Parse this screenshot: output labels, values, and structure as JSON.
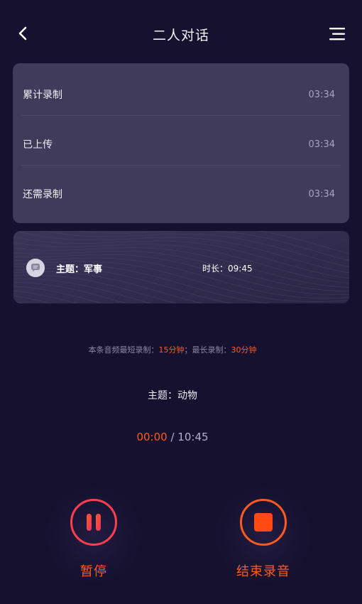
{
  "header": {
    "title": "二人对话",
    "back_icon": "chevron-left-icon",
    "menu_icon": "menu-icon"
  },
  "stats": [
    {
      "label": "累计录制",
      "value": "03:34"
    },
    {
      "label": "已上传",
      "value": "03:34"
    },
    {
      "label": "还需录制",
      "value": "03:34"
    }
  ],
  "topic_card": {
    "avatar_icon": "chat-bubble-icon",
    "topic": "主题：军事",
    "duration": "时长：09:45"
  },
  "limits": {
    "min_prefix": "本条音频最短录制：",
    "min_value": "15分钟",
    "max_prefix": "；最长录制：",
    "max_value": "30分钟"
  },
  "current_topic": "主题：动物",
  "timer": {
    "elapsed": "00:00",
    "separator": " / ",
    "total": "10:45"
  },
  "controls": {
    "pause_label": "暂停",
    "pause_icon": "pause-icon",
    "stop_label": "结束录音",
    "stop_icon": "stop-icon"
  },
  "colors": {
    "background": "#15112e",
    "card": "#403a5b",
    "accent": "#ff5a1f"
  }
}
